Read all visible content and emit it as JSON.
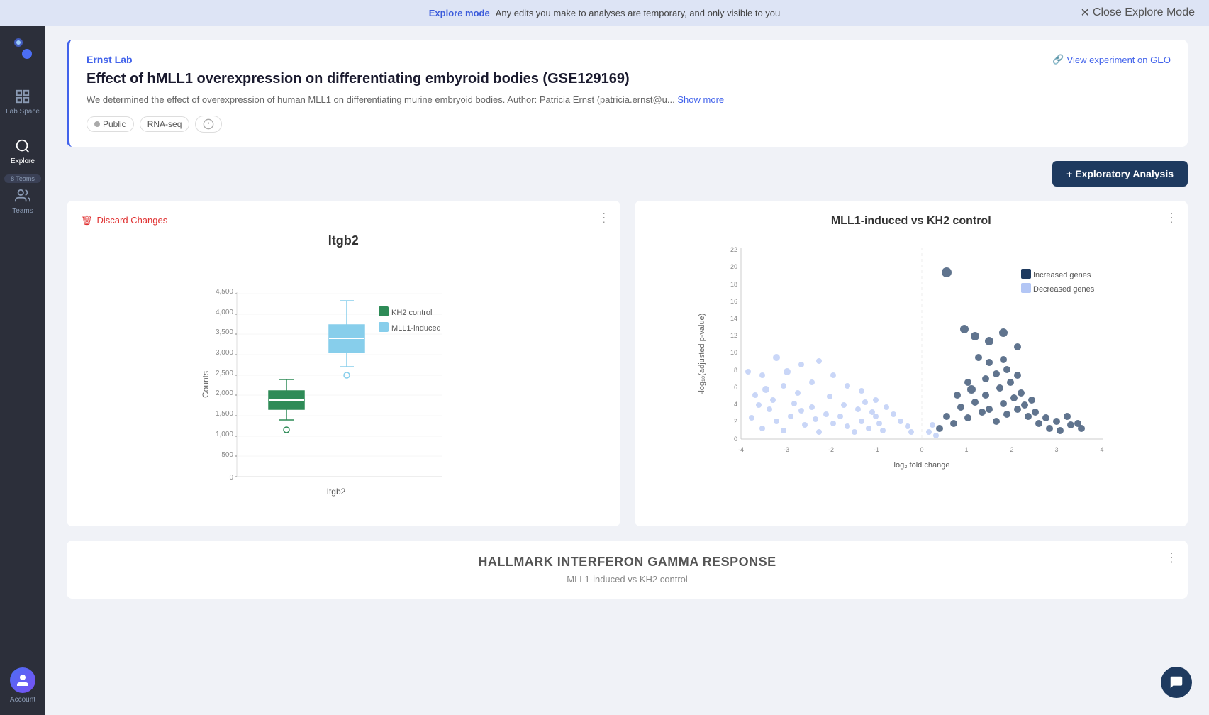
{
  "banner": {
    "mode_label": "Explore mode",
    "message": "Any edits you make to analyses are temporary, and only visible to you",
    "close_label": "Close Explore Mode"
  },
  "sidebar": {
    "logo_alt": "App logo",
    "nav_items": [
      {
        "id": "lab-space",
        "label": "Lab Space",
        "active": false
      },
      {
        "id": "explore",
        "label": "Explore",
        "active": true
      },
      {
        "id": "teams",
        "label": "Teams",
        "active": false
      }
    ],
    "teams_badge": "8 Teams",
    "account_label": "Account",
    "account_initials": ""
  },
  "experiment": {
    "lab": "Ernst Lab",
    "title": "Effect of hMLL1 overexpression on differentiating embyroid bodies (GSE129169)",
    "description": "We determined the effect of overexpression of human MLL1 on differentiating murine embryoid bodies. Author: Patricia Ernst (patricia.ernst@u...",
    "show_more": "Show more",
    "tags": [
      "Public",
      "RNA-seq"
    ],
    "geo_link": "View experiment on GEO"
  },
  "toolbar": {
    "exploratory_btn_label": "+ Exploratory Analysis"
  },
  "boxplot_card": {
    "discard_label": "Discard Changes",
    "title": "Itgb2",
    "x_label": "Itgb2",
    "y_label": "Counts",
    "legend": [
      {
        "color": "#2e8b57",
        "label": "KH2 control"
      },
      {
        "color": "#87ceeb",
        "label": "MLL1-induced"
      }
    ],
    "y_ticks": [
      "0",
      "500",
      "1,000",
      "1,500",
      "2,000",
      "2,500",
      "3,000",
      "3,500",
      "4,000",
      "4,500"
    ]
  },
  "volcano_card": {
    "title": "MLL1-induced vs KH2 control",
    "x_label": "log₂ fold change",
    "y_label": "-log₁₀(adjusted p-value)",
    "x_ticks": [
      "-4",
      "-3",
      "-2",
      "-1",
      "0",
      "1",
      "2",
      "3",
      "4"
    ],
    "y_ticks": [
      "0",
      "2",
      "4",
      "6",
      "8",
      "10",
      "12",
      "14",
      "16",
      "18",
      "20",
      "22"
    ],
    "legend": [
      {
        "color": "#1e3a5f",
        "label": "Increased genes"
      },
      {
        "color": "#a5b4fc",
        "label": "Decreased genes"
      }
    ]
  },
  "bottom_card": {
    "title": "HALLMARK INTERFERON GAMMA RESPONSE",
    "subtitle": "MLL1-induced vs KH2 control",
    "menu_icon": "⋮"
  },
  "menu_icon": "⋮",
  "chat_icon": "💬"
}
